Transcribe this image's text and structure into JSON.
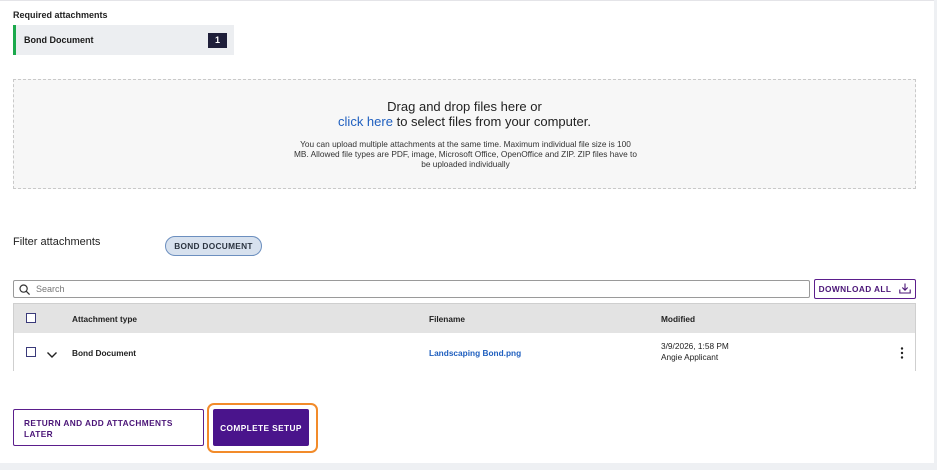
{
  "required_attachments": {
    "title": "Required attachments",
    "items": [
      {
        "label": "Bond Document",
        "count": "1"
      }
    ]
  },
  "dropzone": {
    "line1": "Drag and drop files here or",
    "link": "click here",
    "line2_rest": " to select files from your computer.",
    "note": "You can upload multiple attachments at the same time. Maximum individual file size is 100 MB. Allowed file types are PDF, image, Microsoft Office, OpenOffice and ZIP. ZIP files have to be uploaded individually"
  },
  "filter": {
    "label": "Filter attachments",
    "chip": "BOND DOCUMENT"
  },
  "search": {
    "placeholder": "Search",
    "value": ""
  },
  "download_all": "DOWNLOAD ALL",
  "table": {
    "headers": {
      "type": "Attachment type",
      "filename": "Filename",
      "modified": "Modified"
    },
    "rows": [
      {
        "type": "Bond Document",
        "filename": "Landscaping Bond.png",
        "modified_date": "3/9/2026, 1:58 PM",
        "modified_by": "Angie Applicant"
      }
    ]
  },
  "actions": {
    "return_label": "RETURN AND ADD ATTACHMENTS LATER",
    "complete_label": "COMPLETE SETUP"
  },
  "colors": {
    "accent_purple": "#4a148c",
    "complete_highlight": "#f28b2a",
    "link_blue": "#1f5fbf",
    "required_marker": "#1ba94c"
  },
  "icons": {
    "search": "search-icon",
    "download": "download-icon",
    "expand": "chevron-down-icon",
    "row_menu": "kebab-menu-icon"
  }
}
